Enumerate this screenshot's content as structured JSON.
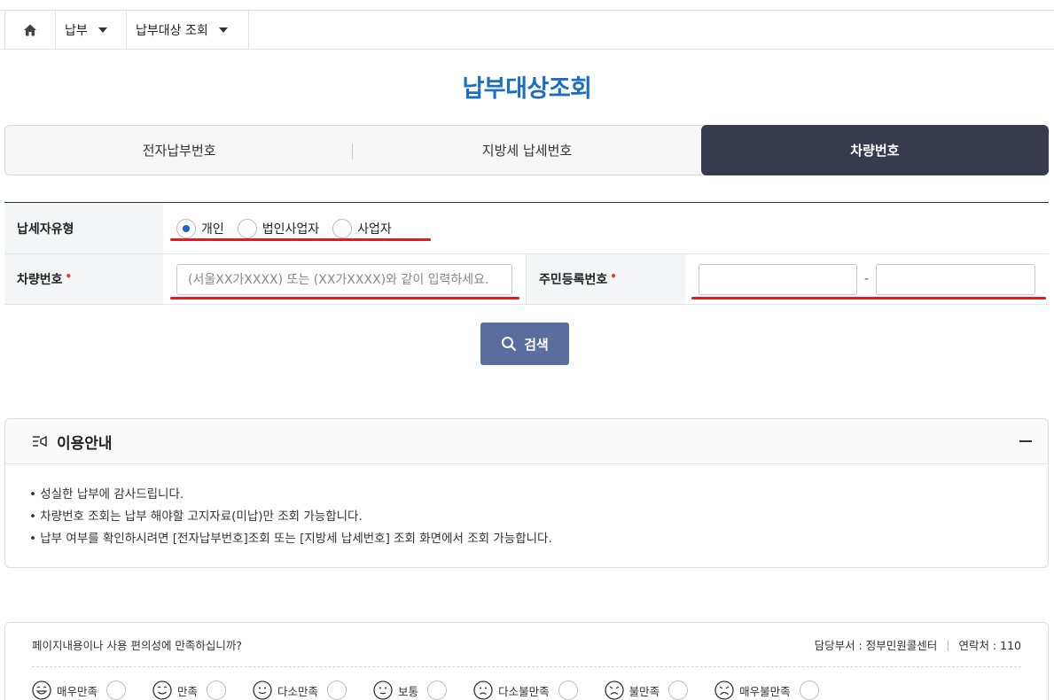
{
  "breadcrumb": {
    "home_icon": "home-icon",
    "items": [
      {
        "label": "납부"
      },
      {
        "label": "납부대상 조회"
      }
    ]
  },
  "page_title": "납부대상조회",
  "tabs": [
    {
      "label": "전자납부번호",
      "active": false
    },
    {
      "label": "지방세 납세번호",
      "active": false
    },
    {
      "label": "차량번호",
      "active": true
    }
  ],
  "form": {
    "taxpayer_type_label": "납세자유형",
    "taxpayer_types": [
      {
        "label": "개인",
        "selected": true
      },
      {
        "label": "법인사업자",
        "selected": false
      },
      {
        "label": "사업자",
        "selected": false
      }
    ],
    "car_number_label": "차량번호",
    "car_number_placeholder": "(서울XX가XXXX) 또는 (XX가XXXX)와 같이 입력하세요.",
    "rrn_label": "주민등록번호",
    "rrn_separator": "-",
    "required_mark": "•"
  },
  "search_button": "검색",
  "info": {
    "title": "이용안내",
    "items": [
      "성실한 납부에 감사드립니다.",
      "차량번호 조회는 납부 해야할 고지자료(미납)만 조회 가능합니다.",
      "납부 여부를 확인하시려면 [전자납부번호]조회 또는 [지방세 납세번호] 조회 화면에서 조회 가능합니다."
    ]
  },
  "satisfaction": {
    "question": "페이지내용이나 사용 편의성에 만족하십니까?",
    "dept": "담당부서 : 정부민원콜센터",
    "contact": "연락처 : 110",
    "options": [
      {
        "label": "매우만족"
      },
      {
        "label": "만족"
      },
      {
        "label": "다소만족"
      },
      {
        "label": "보통"
      },
      {
        "label": "다소불만족"
      },
      {
        "label": "불만족"
      },
      {
        "label": "매우불만족"
      }
    ]
  },
  "colors": {
    "title": "#1a6fc0",
    "active_tab": "#383a4d",
    "search_button": "#5a6e9e",
    "annotation_red": "#e61a1a"
  }
}
